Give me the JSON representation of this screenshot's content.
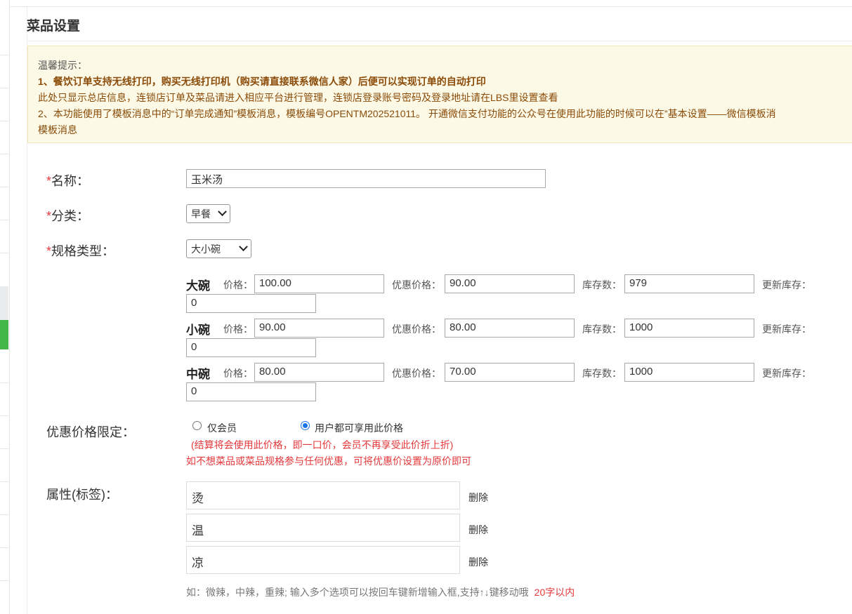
{
  "page": {
    "title": "菜品设置"
  },
  "notice": {
    "heading": "温馨提示：",
    "line1": "1、餐饮订单支持无线打印，购买无线打印机（购买请直接联系微信人家）后便可以实现订单的自动打印",
    "line2": "此处只显示总店信息，连锁店订单及菜品请进入相应平台进行管理，连锁店登录账号密码及登录地址请在LBS里设置查看",
    "line3": "2、本功能使用了模板消息中的“订单完成通知”模板消息，模板编号OPENTM202521011。 开通微信支付功能的公众号在使用此功能的时候可以在”基本设置——微信模板消",
    "line4": "模板消息"
  },
  "form": {
    "required_mark": "*",
    "name_label": "名称：",
    "name_value": "玉米汤",
    "category_label": "分类：",
    "category_value": "早餐",
    "spec_type_label": "规格类型：",
    "spec_type_value": "大小碗",
    "price_label": "价格：",
    "discount_price_label": "优惠价格：",
    "stock_label": "库存数：",
    "update_stock_label": "更新库存：",
    "specs": [
      {
        "name": "大碗",
        "price": "100.00",
        "discount": "90.00",
        "stock": "979",
        "update": "0"
      },
      {
        "name": "小碗",
        "price": "90.00",
        "discount": "80.00",
        "stock": "1000",
        "update": "0"
      },
      {
        "name": "中碗",
        "price": "80.00",
        "discount": "70.00",
        "stock": "1000",
        "update": "0"
      }
    ],
    "discount_limit_label": "优惠价格限定：",
    "radio_member_only": "仅会员",
    "radio_all_users": "用户都可享用此价格",
    "discount_note1": "(结算将会使用此价格，即一口价，会员不再享受此价折上折)",
    "discount_note2": "如不想菜品或菜品规格参与任何优惠，可将优惠价设置为原价即可",
    "attributes_label": "属性(标签)：",
    "attributes": [
      "烫",
      "温",
      "凉"
    ],
    "delete_label": "删除",
    "attributes_hint": "如：微辣，中辣，重辣; 输入多个选项可以按回车键新增输入框,支持↑↓键移动哦",
    "attributes_limit": "20字以内"
  }
}
